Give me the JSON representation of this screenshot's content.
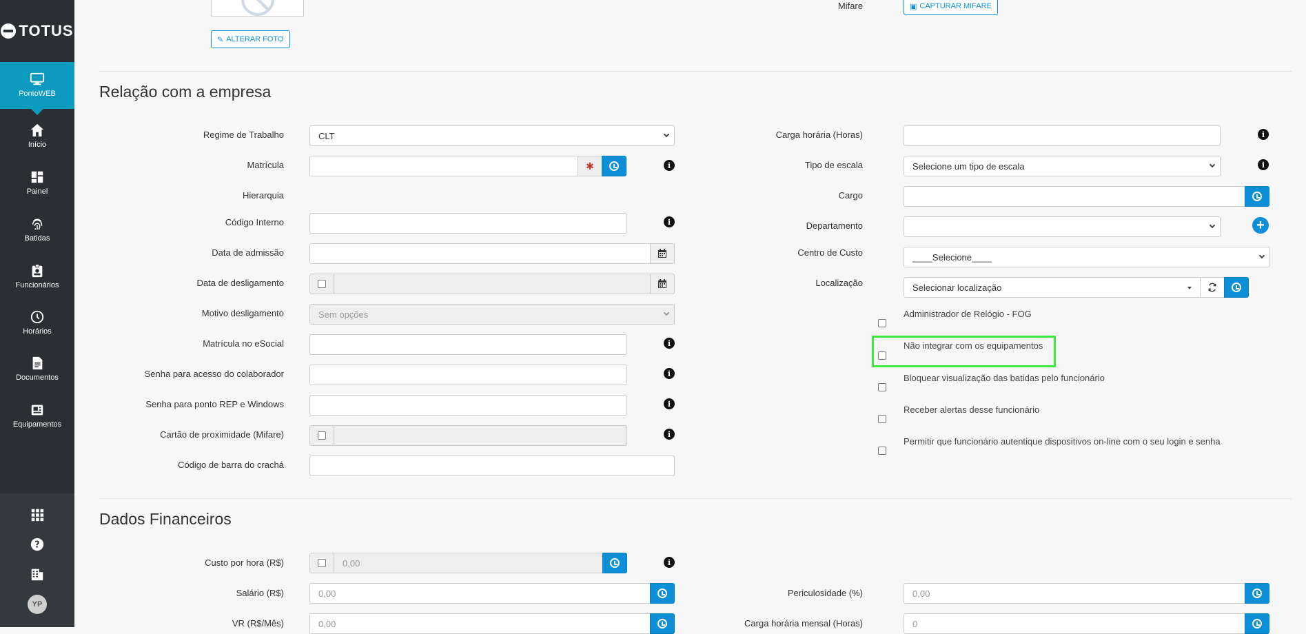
{
  "brand": {
    "logo_text": "TOTUS"
  },
  "sidebar": {
    "active": {
      "label": "PontoWEB",
      "icon": "monitor-icon"
    },
    "items": [
      {
        "label": "Início",
        "icon": "home-icon"
      },
      {
        "label": "Painel",
        "icon": "dashboard-icon"
      },
      {
        "label": "Batidas",
        "icon": "fingerprint-icon"
      },
      {
        "label": "Funcionários",
        "icon": "badge-icon"
      },
      {
        "label": "Horários",
        "icon": "clock-icon"
      },
      {
        "label": "Documentos",
        "icon": "document-icon"
      },
      {
        "label": "Equipamentos",
        "icon": "device-icon"
      }
    ],
    "bottom_icons": [
      "apps-grid-icon",
      "help-icon",
      "building-icon"
    ],
    "avatar": "YP"
  },
  "top": {
    "alterar_foto": "ALTERAR FOTO",
    "mifare_label": "Mifare",
    "capturar_mifare": "CAPTURAR MIFARE"
  },
  "relacao": {
    "title": "Relação com a empresa",
    "left": {
      "regime_label": "Regime de Trabalho",
      "regime_value": "CLT",
      "matricula_label": "Matrícula",
      "hierarquia_label": "Hierarquia",
      "codigo_interno_label": "Código Interno",
      "admissao_label": "Data de admissão",
      "desligamento_label": "Data de desligamento",
      "motivo_label": "Motivo desligamento",
      "motivo_value": "Sem opções",
      "esocial_label": "Matrícula no eSocial",
      "senha_colab_label": "Senha para acesso do colaborador",
      "senha_rep_label": "Senha para ponto REP e Windows",
      "cartao_label": "Cartão de proximidade (Mifare)",
      "codigo_barra_label": "Código de barra do crachá"
    },
    "right": {
      "carga_label": "Carga horária (Horas)",
      "tipo_escala_label": "Tipo de escala",
      "tipo_escala_value": "Selecione um tipo de escala",
      "cargo_label": "Cargo",
      "departamento_label": "Departamento",
      "centro_label": "Centro de Custo",
      "centro_value": "____Selecione____",
      "localizacao_label": "Localização",
      "localizacao_value": "Selecionar localização",
      "checkboxes": [
        "Administrador de Relógio - FOG",
        "Não integrar com os equipamentos",
        "Bloquear visualização das batidas pelo funcionário",
        "Receber alertas desse funcionário",
        "Permitir que funcionário autentique dispositivos on-line com o seu login e senha"
      ]
    }
  },
  "financeiro": {
    "title": "Dados Financeiros",
    "custo_label": "Custo por hora (R$)",
    "custo_placeholder": "0,00",
    "salario_label": "Salário (R$)",
    "salario_placeholder": "0,00",
    "vr_label": "VR (R$/Mês)",
    "vr_placeholder": "0,00",
    "periculosidade_label": "Periculosidade (%)",
    "periculosidade_placeholder": "0,00",
    "carga_mensal_label": "Carga horária mensal (Horas)",
    "carga_mensal_placeholder": "0"
  },
  "colors": {
    "sidebar": "#2b2e33",
    "accent": "#0c9abe",
    "button": "#0c8fd6",
    "highlight": "#3fe83f"
  }
}
